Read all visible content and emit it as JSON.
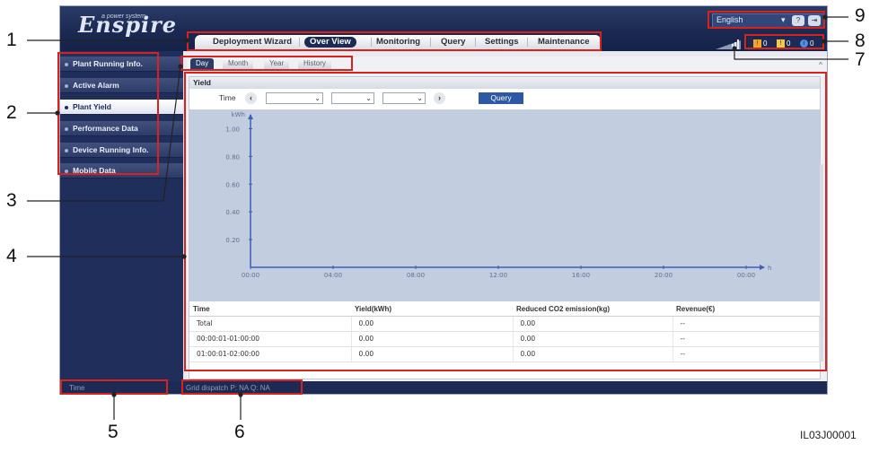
{
  "header": {
    "logo_text": "Enspire",
    "logo_subtext": "a power system",
    "language": "English",
    "language_caret": "▾",
    "help_icon": "?",
    "logout_icon": "⇥"
  },
  "top_tabs": [
    {
      "label": "Deployment Wizard"
    },
    {
      "label": "Over View"
    },
    {
      "label": "Monitoring"
    },
    {
      "label": "Query"
    },
    {
      "label": "Settings"
    },
    {
      "label": "Maintenance"
    }
  ],
  "alarms": {
    "major": "0",
    "minor": "0",
    "warning": "0",
    "colors": {
      "major": "#f5a623",
      "minor": "#f2c94c",
      "warning": "#4a90e2"
    }
  },
  "sidebar": {
    "items": [
      {
        "label": "Plant Running Info."
      },
      {
        "label": "Active Alarm"
      },
      {
        "label": "Plant Yield"
      },
      {
        "label": "Performance Data"
      },
      {
        "label": "Device Running Info."
      },
      {
        "label": "Mobile Data"
      }
    ]
  },
  "sub_tabs": [
    {
      "label": "Day"
    },
    {
      "label": "Month"
    },
    {
      "label": "Year"
    },
    {
      "label": "History"
    }
  ],
  "panel": {
    "title": "Yield",
    "time_label": "Time",
    "prev_icon": "‹",
    "next_icon": "›",
    "query_button": "Query",
    "select_caret": "⌄"
  },
  "chart_data": {
    "type": "line",
    "ylabel": "kWh",
    "xlabel": "h",
    "y_ticks": [
      "0.20",
      "0.40",
      "0.60",
      "0.80",
      "1.00"
    ],
    "x_ticks": [
      "00:00",
      "04:00",
      "08:00",
      "12:00",
      "16:00",
      "20:00",
      "00:00"
    ],
    "ylim": [
      0,
      1.1
    ],
    "series": [],
    "grid": false
  },
  "table": {
    "headers": [
      "Time",
      "Yield(kWh)",
      "Reduced CO2 emission(kg)",
      "Revenue(€)"
    ],
    "rows": [
      [
        "Total",
        "0.00",
        "0.00",
        "--"
      ],
      [
        "00:00:01-01:00:00",
        "0.00",
        "0.00",
        "--"
      ],
      [
        "01:00:01-02:00:00",
        "0.00",
        "0.00",
        "--"
      ]
    ]
  },
  "status_bar": {
    "time_label": "Time",
    "grid_dispatch": "Grid dispatch   P: NA    Q: NA"
  },
  "callouts": [
    "1",
    "2",
    "3",
    "4",
    "5",
    "6",
    "7",
    "8",
    "9"
  ],
  "figure_id": "IL03J00001",
  "colors": {
    "accent": "#1c2b56",
    "highlight": "#d9211d",
    "query": "#2c58a6"
  }
}
